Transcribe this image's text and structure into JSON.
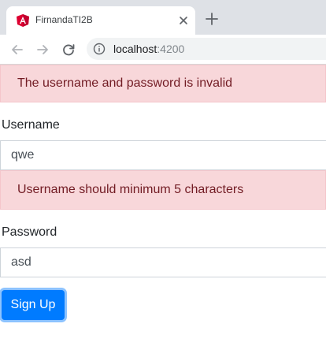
{
  "browser": {
    "tab_title": "FirnandaTI2B",
    "url_host": "localhost",
    "url_port": ":4200",
    "favicon": "angular-icon",
    "accent": "#dd0031"
  },
  "form": {
    "error_invalid": "The username and password is invalid",
    "username_label": "Username",
    "username_value": "qwe",
    "username_error": "Username should minimum 5 characters",
    "password_label": "Password",
    "password_value": "asd",
    "submit_label": "Sign Up"
  },
  "colors": {
    "alert_bg": "#f8d7da",
    "alert_text": "#721c24",
    "primary": "#007bff"
  }
}
